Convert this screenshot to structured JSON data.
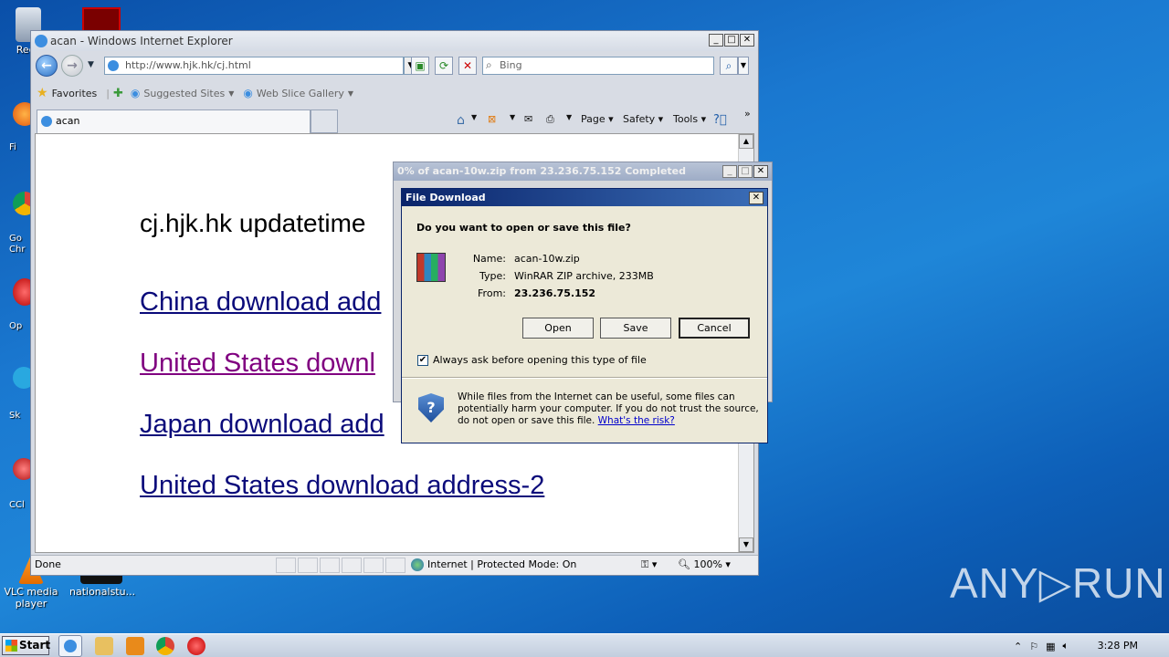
{
  "desktop": {
    "icons": [
      {
        "label": "Recy"
      },
      {
        "label": "Fi"
      },
      {
        "label": "Go Chr"
      },
      {
        "label": "Op"
      },
      {
        "label": "Sk"
      },
      {
        "label": "CCl"
      },
      {
        "label": "VLC media player"
      },
      {
        "label": "nationalstu..."
      }
    ]
  },
  "ie": {
    "title": "acan - Windows Internet Explorer",
    "address": "http://www.hjk.hk/cj.html",
    "search_placeholder": "Bing",
    "favorites": "Favorites",
    "suggested_sites": "Suggested Sites",
    "web_slice": "Web Slice Gallery",
    "tab_title": "acan",
    "commands": {
      "page": "Page",
      "safety": "Safety",
      "tools": "Tools"
    },
    "status": {
      "left": "Done",
      "zone": "Internet | Protected Mode: On",
      "zoom": "100%"
    }
  },
  "page": {
    "heading": "cj.hjk.hk updatetime",
    "links": [
      {
        "text": "China download add",
        "visited": false
      },
      {
        "text": "United States downl",
        "visited": true
      },
      {
        "text": "Japan download add",
        "visited": false
      },
      {
        "text": "United States download address-2",
        "visited": false
      }
    ]
  },
  "progress_window": {
    "title": "0% of acan-10w.zip from 23.236.75.152 Completed"
  },
  "file_dialog": {
    "title": "File Download",
    "question": "Do you want to open or save this file?",
    "name_label": "Name:",
    "name": "acan-10w.zip",
    "type_label": "Type:",
    "type": "WinRAR ZIP archive, 233MB",
    "from_label": "From:",
    "from": "23.236.75.152",
    "open": "Open",
    "save": "Save",
    "cancel": "Cancel",
    "checkbox": "Always ask before opening this type of file",
    "warning": "While files from the Internet can be useful, some files can potentially harm your computer. If you do not trust the source, do not open or save this file.",
    "risk_link": "What's the risk?"
  },
  "taskbar": {
    "start": "Start",
    "clock": "3:28 PM"
  },
  "watermark": "ANY▷RUN"
}
